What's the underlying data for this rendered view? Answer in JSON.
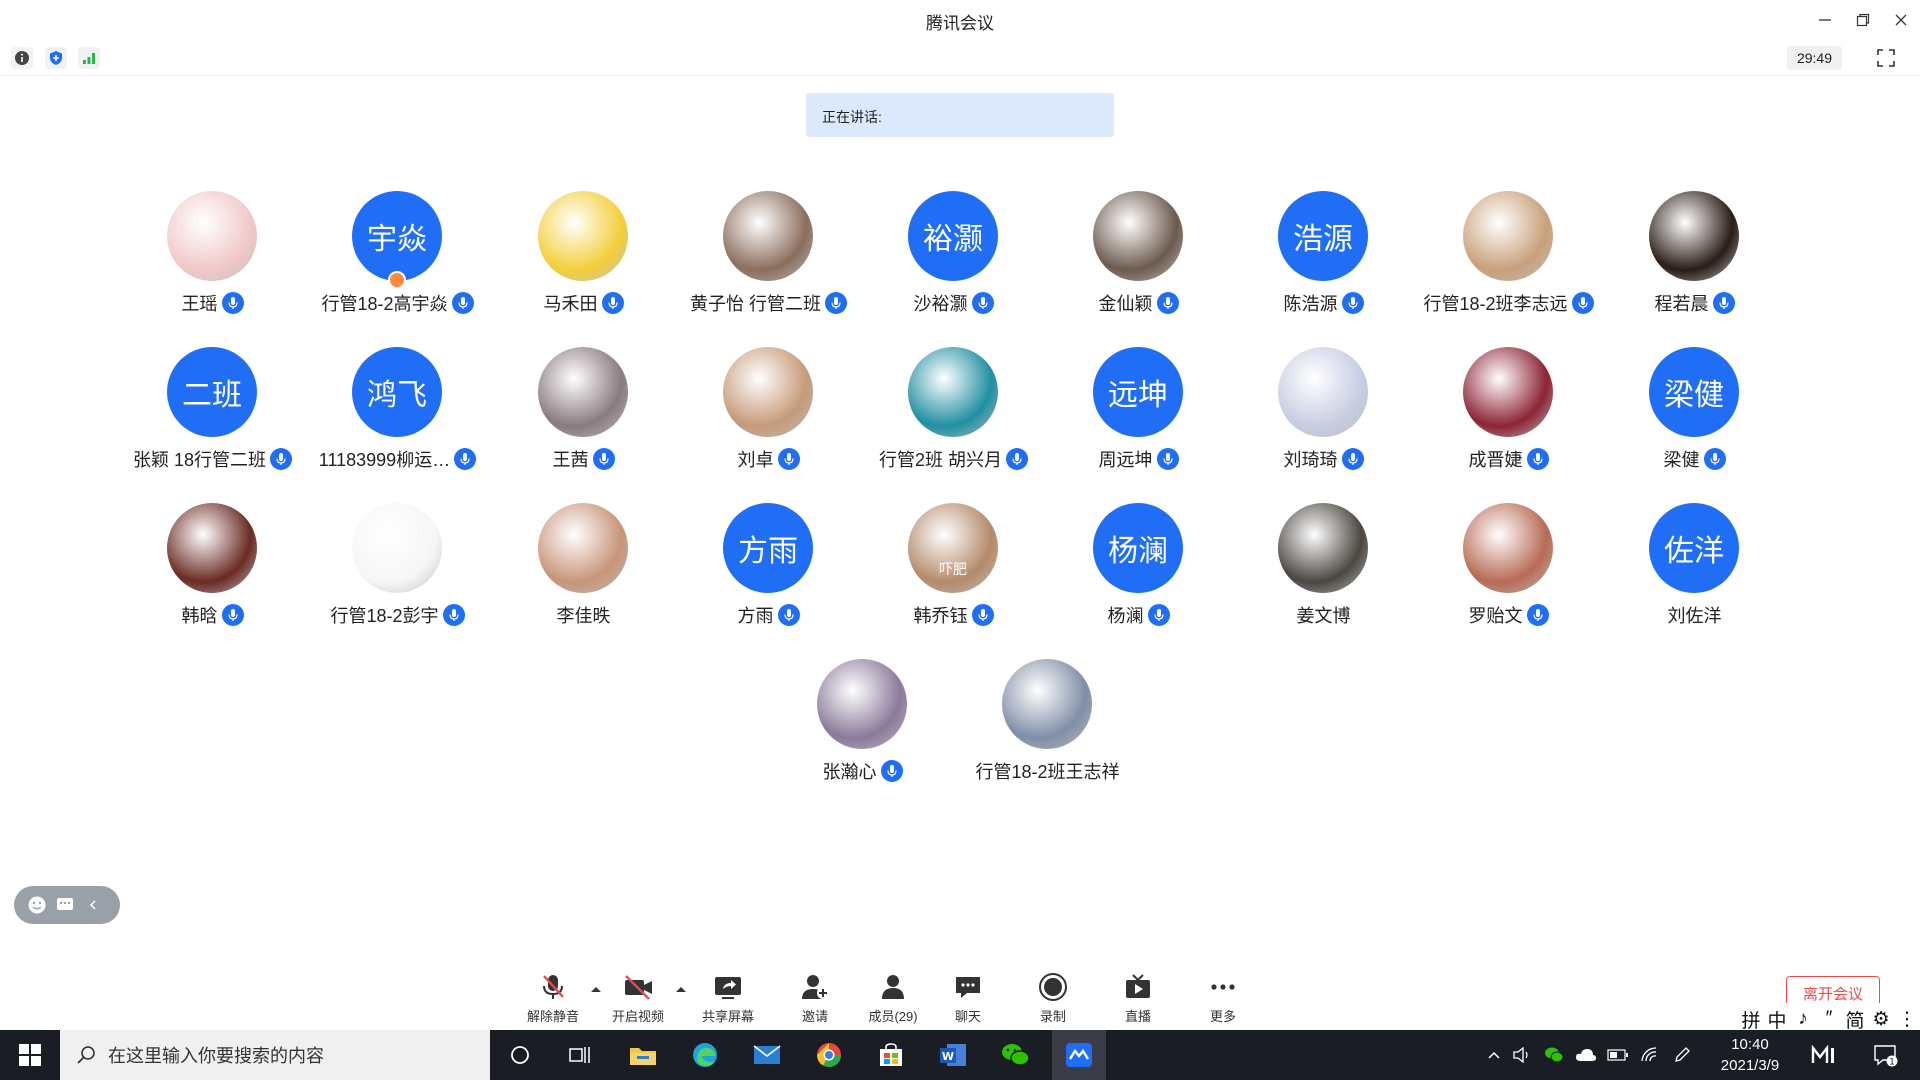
{
  "window": {
    "title": "腾讯会议",
    "timer": "29:49",
    "speaking_label": "正在讲话:"
  },
  "participants": [
    {
      "name": "王瑶",
      "avatar_type": "image",
      "avatar_color": "#f1c8c8",
      "mic": true
    },
    {
      "name": "行管18-2高宇焱",
      "avatar_type": "text",
      "avatar_text": "宇焱",
      "mic": true,
      "host": true
    },
    {
      "name": "马禾田",
      "avatar_type": "image",
      "avatar_color": "#f3cf3a",
      "mic": true
    },
    {
      "name": "黄子怡 行管二班",
      "avatar_type": "image",
      "avatar_color": "#8a6e5c",
      "mic": true
    },
    {
      "name": "沙裕灏",
      "avatar_type": "text",
      "avatar_text": "裕灏",
      "mic": true
    },
    {
      "name": "金仙颖",
      "avatar_type": "image",
      "avatar_color": "#6d5a4e",
      "mic": true
    },
    {
      "name": "陈浩源",
      "avatar_type": "text",
      "avatar_text": "浩源",
      "mic": true
    },
    {
      "name": "行管18-2班李志远",
      "avatar_type": "image",
      "avatar_color": "#c9a07a",
      "mic": true
    },
    {
      "name": "程若晨",
      "avatar_type": "image",
      "avatar_color": "#2a1c16",
      "mic": true
    },
    {
      "name": "张颖 18行管二班",
      "avatar_type": "text",
      "avatar_text": "二班",
      "mic": true
    },
    {
      "name": "11183999柳运…",
      "avatar_type": "text",
      "avatar_text": "鸿飞",
      "mic": true
    },
    {
      "name": "王茜",
      "avatar_type": "image",
      "avatar_color": "#8a7a80",
      "mic": true
    },
    {
      "name": "刘卓",
      "avatar_type": "image",
      "avatar_color": "#c69a78",
      "mic": true
    },
    {
      "name": "行管2班 胡兴月",
      "avatar_type": "image",
      "avatar_color": "#1f8fa2",
      "mic": true
    },
    {
      "name": "周远坤",
      "avatar_type": "text",
      "avatar_text": "远坤",
      "mic": true
    },
    {
      "name": "刘琦琦",
      "avatar_type": "image",
      "avatar_color": "#c7cde2",
      "mic": true
    },
    {
      "name": "成晋婕",
      "avatar_type": "image",
      "avatar_color": "#8c2435",
      "mic": true
    },
    {
      "name": "梁健",
      "avatar_type": "text",
      "avatar_text": "梁健",
      "mic": true
    },
    {
      "name": "韩晗",
      "avatar_type": "image",
      "avatar_color": "#6a2a22",
      "mic": true
    },
    {
      "name": "行管18-2彭宇",
      "avatar_type": "image",
      "avatar_color": "#f6f6f6",
      "mic": true
    },
    {
      "name": "李佳昳",
      "avatar_type": "image",
      "avatar_color": "#c89478",
      "mic": false
    },
    {
      "name": "方雨",
      "avatar_type": "text",
      "avatar_text": "方雨",
      "mic": true
    },
    {
      "name": "韩乔钰",
      "avatar_type": "image",
      "avatar_color": "#b48a6a",
      "mic": true,
      "avatar_caption": "吓肥"
    },
    {
      "name": "杨澜",
      "avatar_type": "text",
      "avatar_text": "杨澜",
      "mic": true
    },
    {
      "name": "姜文博",
      "avatar_type": "image",
      "avatar_color": "#4b4640",
      "mic": false
    },
    {
      "name": "罗贻文",
      "avatar_type": "image",
      "avatar_color": "#b86a54",
      "mic": true
    },
    {
      "name": "刘佐洋",
      "avatar_type": "text",
      "avatar_text": "佐洋",
      "mic": false
    },
    {
      "name": "张瀚心",
      "avatar_type": "image",
      "avatar_color": "#8a7a9a",
      "mic": true
    },
    {
      "name": "行管18-2班王志祥",
      "avatar_type": "image",
      "avatar_color": "#7f8ea6",
      "mic": false
    }
  ],
  "controls": {
    "unmute": "解除静音",
    "start_video": "开启视频",
    "share_screen": "共享屏幕",
    "invite": "邀请",
    "members": "成员(29)",
    "chat": "聊天",
    "record": "录制",
    "live": "直播",
    "more": "更多",
    "leave": "离开会议"
  },
  "ime": [
    "拼",
    "中",
    "♪",
    "″",
    "简",
    "⚙",
    "⋮"
  ],
  "taskbar": {
    "search_placeholder": "在这里输入你要搜索的内容",
    "time": "10:40",
    "date": "2021/3/9",
    "notification_count": "1"
  },
  "colors": {
    "accent": "#1f6ef5",
    "speaking_bg": "#dce9fd",
    "leave": "#e84b4b",
    "taskbar": "#1b1d24"
  }
}
